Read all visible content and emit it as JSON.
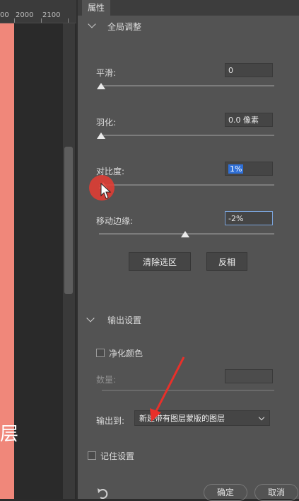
{
  "ruler": {
    "labels": [
      "00",
      "2000",
      "2100"
    ]
  },
  "caption": "层",
  "panel": {
    "tab_title": "属性",
    "global_section": "全局调整",
    "smooth": {
      "label": "平滑:",
      "value": "0",
      "slider": 0.0
    },
    "feather": {
      "label": "羽化:",
      "value": "0.0 像素",
      "slider": 0.0
    },
    "contrast": {
      "label": "对比度:",
      "value": "1%",
      "slider": 0.01
    },
    "shift_edge": {
      "label": "移动边缘:",
      "value": "-2%",
      "slider": 0.49
    },
    "clear_selection_button": "清除选区",
    "invert_button": "反相",
    "output_section": "输出设置",
    "decontaminate": {
      "label": "净化颜色",
      "checked": false
    },
    "amount": {
      "label": "数量:",
      "value": ""
    },
    "output_to": {
      "label": "输出到:",
      "value": "新建带有图层蒙版的图层"
    },
    "remember": {
      "label": "记住设置",
      "checked": false
    },
    "ok_button": "确定",
    "cancel_button": "取消"
  },
  "colors": {
    "canvas": "#f0877a",
    "panel": "#535353",
    "accent": "#2f6fd6",
    "annotation": "#e8302a"
  }
}
